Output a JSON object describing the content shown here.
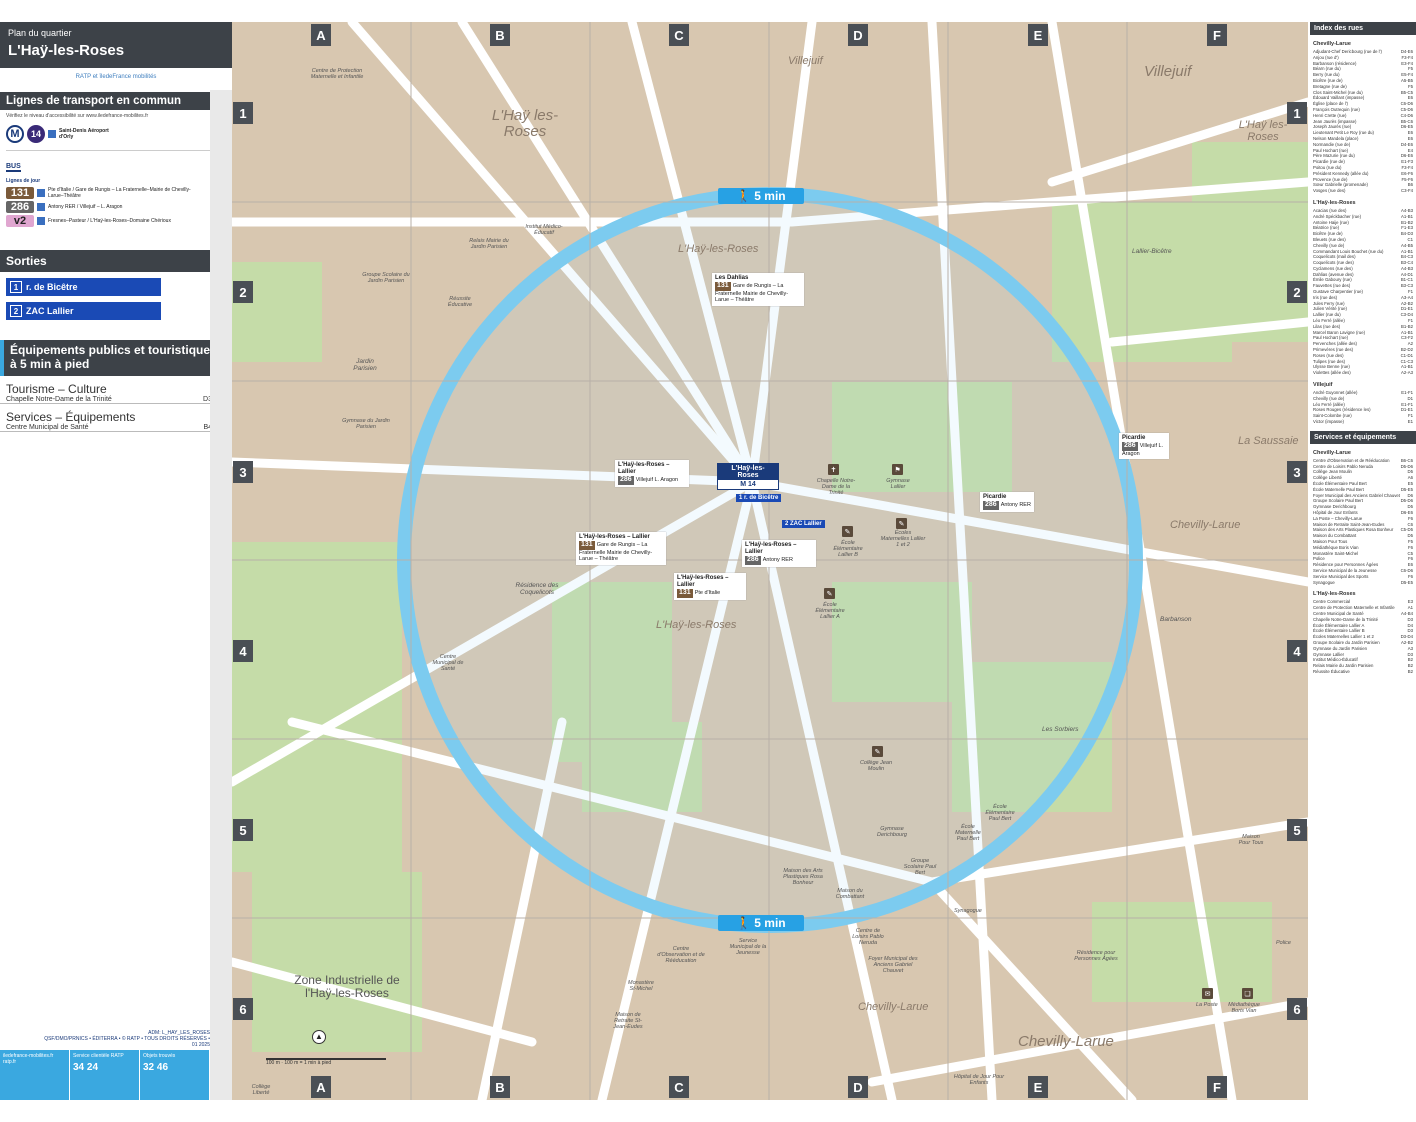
{
  "header": {
    "subtitle": "Plan du quartier",
    "title": "L'Haÿ-les-Roses"
  },
  "logos": {
    "text": "RATP  et  îledeFrance mobilités"
  },
  "transport": {
    "heading": "Lignes de transport en commun",
    "note": "Vérifiez le niveau d'accessibilité sur www.iledefrance-mobilites.fr",
    "metro": {
      "m": "M",
      "line": "14",
      "dest": "Saint-Denis Aéroport d'Orly"
    },
    "bus_label": "BUS",
    "lignes_label": "Lignes de jour",
    "lines": [
      {
        "num": "131",
        "desc": "Pte d'Italie / Gare de Rungis – La Fraternelle–Mairie de Chevilly-Larue–Théâtre",
        "color": "#7a5a3a"
      },
      {
        "num": "286",
        "desc": "Antony RER / Villejuif – L. Aragon",
        "color": "#666666"
      },
      {
        "num": "v2",
        "desc": "Fresnes–Pasteur / L'Haÿ-les-Roses–Domaine Chérioux",
        "color": "#e0a6d0"
      }
    ]
  },
  "sorties": {
    "heading": "Sorties",
    "items": [
      {
        "num": "1",
        "label": "r. de Bicêtre"
      },
      {
        "num": "2",
        "label": "ZAC Lallier"
      }
    ]
  },
  "equipements": {
    "heading": "Équipements publics et touristiques à 5 min à pied",
    "categories": [
      {
        "title": "Tourisme – Culture",
        "items": [
          {
            "name": "Chapelle Notre-Dame de la Trinité",
            "ref": "D3"
          }
        ]
      },
      {
        "title": "Services – Équipements",
        "items": [
          {
            "name": "Centre Municipal de Santé",
            "ref": "B4"
          }
        ]
      }
    ]
  },
  "credits": {
    "ref": "ADM: L_HAY_LES_ROSES",
    "line2": "QSF/DMO/PRNICS • ÉDITERRA • © RATP • TOUS DROITS RÉSERVÉS • 01 2025"
  },
  "footer": [
    {
      "title": "iledefrance-mobilites.fr ratp.fr",
      "num": ""
    },
    {
      "title": "Service clientèle RATP",
      "num": "34 24"
    },
    {
      "title": "Objets trouvés",
      "num": "32 46"
    }
  ],
  "grid": {
    "letters": [
      "A",
      "B",
      "C",
      "D",
      "E",
      "F"
    ],
    "numbers": [
      "1",
      "2",
      "3",
      "4",
      "5",
      "6"
    ]
  },
  "map": {
    "walk_label": "5 min",
    "places": [
      {
        "name": "L'Haÿ les-Roses"
      },
      {
        "name": "Villejuif"
      },
      {
        "name": "Villejuif"
      },
      {
        "name": "L'Haÿ les-Roses"
      },
      {
        "name": "L'Haÿ-les-Roses"
      },
      {
        "name": "L'Haÿ-les-Roses"
      },
      {
        "name": "La Saussaie"
      },
      {
        "name": "Chevilly-Larue"
      },
      {
        "name": "Chevilly-Larue"
      },
      {
        "name": "Chevilly-Larue"
      },
      {
        "name": "Lallier-Bicêtre"
      },
      {
        "name": "Jardin Parisien"
      },
      {
        "name": "Barbanson"
      },
      {
        "name": "Les Sorbiers"
      },
      {
        "name": "Résidence des Coquelicots"
      },
      {
        "name": "Zone Industrielle de l'Haÿ-les-Roses"
      }
    ],
    "station": {
      "name": "L'Haÿ-les-Roses",
      "m": "M",
      "line": "14"
    },
    "exits": [
      {
        "num": "1",
        "label": "r. de Bicêtre"
      },
      {
        "num": "2",
        "label": "ZAC Lallier"
      }
    ],
    "stops": [
      {
        "name": "Les Dahlias",
        "line": "131",
        "dir": "Gare de Rungis – La Fraternelle Mairie de Chevilly-Larue – Théâtre"
      },
      {
        "name": "L'Haÿ-les-Roses – Lallier",
        "line": "286",
        "dir": "Villejuif L. Aragon"
      },
      {
        "name": "L'Haÿ-les-Roses – Lallier",
        "line": "131",
        "dir": "Gare de Rungis – La Fraternelle Mairie de Chevilly-Larue – Théâtre"
      },
      {
        "name": "L'Haÿ-les-Roses – Lallier",
        "line": "286",
        "dir": "Antony RER"
      },
      {
        "name": "L'Haÿ-les-Roses – Lallier",
        "line": "131",
        "dir": "Pte d'Italie"
      },
      {
        "name": "Picardie",
        "line": "286",
        "dir": "Antony RER"
      },
      {
        "name": "Picardie",
        "line": "286",
        "dir": "Villejuif L. Aragon"
      }
    ],
    "pois": [
      {
        "name": "Centre de Protection Maternelle et Infantile"
      },
      {
        "name": "Relais Mairie du Jardin Parisien"
      },
      {
        "name": "Institut Médico-Éducatif"
      },
      {
        "name": "Groupe Scolaire du Jardin Parisien"
      },
      {
        "name": "Réussite Éducative"
      },
      {
        "name": "Gymnase du Jardin Parisien"
      },
      {
        "name": "Chapelle Notre-Dame de la Trinité"
      },
      {
        "name": "Gymnase Lallier"
      },
      {
        "name": "École Élémentaire Lallier B"
      },
      {
        "name": "Écoles Maternelles Lallier 1 et 2"
      },
      {
        "name": "École Élémentaire Lallier A"
      },
      {
        "name": "Centre Municipal de Santé"
      },
      {
        "name": "Collège Jean Moulin"
      },
      {
        "name": "Gymnase Derichbourg"
      },
      {
        "name": "Groupe Scolaire Paul Bert"
      },
      {
        "name": "École Élémentaire Paul Bert"
      },
      {
        "name": "École Maternelle Paul Bert"
      },
      {
        "name": "Synagogue"
      },
      {
        "name": "Maison des Arts Plastiques Rosa Bonheur"
      },
      {
        "name": "Maison du Combattant"
      },
      {
        "name": "Service Municipal de la Jeunesse"
      },
      {
        "name": "Centre d'Observation et de Rééducation"
      },
      {
        "name": "Centre de Loisirs Pablo Neruda"
      },
      {
        "name": "Foyer Municipal des Anciens Gabriel Chauvet"
      },
      {
        "name": "Résidence pour Personnes Âgées"
      },
      {
        "name": "Monastère St-Michel"
      },
      {
        "name": "Maison de Retraite St-Jean-Eudes"
      },
      {
        "name": "Hôpital de Jour Pour Enfants"
      },
      {
        "name": "La Poste"
      },
      {
        "name": "Médiathèque Boris Vian"
      },
      {
        "name": "Maison Pour Tous"
      },
      {
        "name": "Police"
      },
      {
        "name": "Collège Liberté"
      }
    ],
    "scale": "100 m",
    "scale_sub": "100 m = 1 min à pied"
  },
  "index": {
    "heading": "Index des rues",
    "groups": [
      {
        "name": "Chevilly-Larue",
        "items": [
          [
            "Adjudant-Chef Dericbourg (rue de l')",
            "D4-E6"
          ],
          [
            "Anjou (rue d')",
            "F3-F4"
          ],
          [
            "Barbanson (résidence)",
            "E3-F4"
          ],
          [
            "Béarn (rue du)",
            "F5"
          ],
          [
            "Berry (rue du)",
            "E5-F4"
          ],
          [
            "Bicêtre (rue de)",
            "A5-B5"
          ],
          [
            "Bretagne (rue de)",
            "F5"
          ],
          [
            "Clos Saint-Michel (rue du)",
            "B5-C5"
          ],
          [
            "Édouard Vaillant (impasse)",
            "E6"
          ],
          [
            "Église (place de l')",
            "C6-D6"
          ],
          [
            "François Outrequin (rue)",
            "C5-D6"
          ],
          [
            "Henri Crette (rue)",
            "C4-D6"
          ],
          [
            "Jean Jaurès (impasse)",
            "B5-C6"
          ],
          [
            "Joseph Jaurès (rue)",
            "D6-E5"
          ],
          [
            "Lieutenant Petit Le Roy (rue du)",
            "E6"
          ],
          [
            "Nelson Mandela (place)",
            "E6"
          ],
          [
            "Normandie (rue de)",
            "D4-E6"
          ],
          [
            "Paul Hochart (rue)",
            "E4"
          ],
          [
            "Père Mazurie (rue du)",
            "D6-E6"
          ],
          [
            "Picardie (rue de)",
            "E1-F3"
          ],
          [
            "Poitou (rue du)",
            "F3-F4"
          ],
          [
            "Président Kennedy (allée du)",
            "E6-F6"
          ],
          [
            "Provence (rue de)",
            "F5-F6"
          ],
          [
            "Sœur Gabrielle (promenade)",
            "B6"
          ],
          [
            "Vosges (rue des)",
            "C3-F4"
          ]
        ]
      },
      {
        "name": "L'Haÿ-les-Roses",
        "items": [
          [
            "Acacias (rue des)",
            "A4-B3"
          ],
          [
            "André Spéckbacher (rue)",
            "A1-B1"
          ],
          [
            "Antoine Haije (rue)",
            "B1-B2"
          ],
          [
            "Béatrice (rue)",
            "F1-E3"
          ],
          [
            "Bicêtre (rue de)",
            "B4-D3"
          ],
          [
            "Bleuets (rue des)",
            "C1"
          ],
          [
            "Chevilly (rue de)",
            "A4-B5"
          ],
          [
            "Commandant Louis Bouchet (rue du)",
            "A1-B1"
          ],
          [
            "Coquelicots (mail des)",
            "B4-C3"
          ],
          [
            "Coquelicots (rue des)",
            "B3-C4"
          ],
          [
            "Cyclamens (rue des)",
            "A4-B3"
          ],
          [
            "Dahlias (avenue des)",
            "A4-D1"
          ],
          [
            "Émile Gaboury (rue)",
            "B1-C1"
          ],
          [
            "Fauvettes (rue des)",
            "B3-C3"
          ],
          [
            "Gustave Charpentier (rue)",
            "F1"
          ],
          [
            "Iris (rue des)",
            "A3-A4"
          ],
          [
            "Jules Ferry (rue)",
            "A2-B2"
          ],
          [
            "Julien Vérité (rue)",
            "D1-E1"
          ],
          [
            "Lallier (rue du)",
            "C3-D4"
          ],
          [
            "Léo Ferré (allée)",
            "F1"
          ],
          [
            "Lilas (rue des)",
            "B1-B2"
          ],
          [
            "Marcel Baron Lavigne (rue)",
            "A1-B1"
          ],
          [
            "Paul Hochart (rue)",
            "C3-F2"
          ],
          [
            "Pervenches (allée des)",
            "A2"
          ],
          [
            "Primevères (rue des)",
            "B2-D2"
          ],
          [
            "Roses (rue des)",
            "C1-D1"
          ],
          [
            "Tulipes (rue des)",
            "C1-C3"
          ],
          [
            "Ulysse Benne (rue)",
            "A1-B1"
          ],
          [
            "Violettes (allée des)",
            "A2-A3"
          ]
        ]
      },
      {
        "name": "Villejuif",
        "items": [
          [
            "André Guyonnet (allée)",
            "E1-F1"
          ],
          [
            "Chevilly (rue de)",
            "D1"
          ],
          [
            "Léo Ferré (allée)",
            "E1-F1"
          ],
          [
            "Roses Rouges (résidence les)",
            "D1-E1"
          ],
          [
            "Saint-Colombe (rue)",
            "F1"
          ],
          [
            "Victor (impasse)",
            "E1"
          ]
        ]
      }
    ],
    "services_heading": "Services et équipements",
    "services_groups": [
      {
        "name": "Chevilly-Larue",
        "items": [
          [
            "Centre d'Observation et de Rééducation",
            "B6-C6"
          ],
          [
            "Centre de Loisirs Pablo Neruda",
            "D5-D6"
          ],
          [
            "Collège Jean Moulin",
            "D5"
          ],
          [
            "Collège Liberté",
            "A6"
          ],
          [
            "École Élémentaire Paul Bert",
            "E5"
          ],
          [
            "École Maternelle Paul Bert",
            "D5-E5"
          ],
          [
            "Foyer Municipal des Anciens Gabriel Chauvet",
            "D6"
          ],
          [
            "Groupe Scolaire Paul Bert",
            "D5-D6"
          ],
          [
            "Gymnase Derichbourg",
            "D5"
          ],
          [
            "Hôpital de Jour Enfants",
            "D6-E6"
          ],
          [
            "La Poste – Chevilly-Larue",
            "F6"
          ],
          [
            "Maison de Retraite Saint-Jean-Eudes",
            "C6"
          ],
          [
            "Maison des Arts Plastiques Rosa Bonheur",
            "C5-D5"
          ],
          [
            "Maison du Combattant",
            "D5"
          ],
          [
            "Maison Pour Tous",
            "F5"
          ],
          [
            "Médiathèque Boris Vian",
            "F6"
          ],
          [
            "Monastère Saint-Michel",
            "C5"
          ],
          [
            "Police",
            "F6"
          ],
          [
            "Résidence pour Personnes Âgées",
            "E6"
          ],
          [
            "Service Municipal de la Jeunesse",
            "C6-D6"
          ],
          [
            "Service Municipal des Sports",
            "F6"
          ],
          [
            "Synagogue",
            "D5-E5"
          ]
        ]
      },
      {
        "name": "L'Haÿ-les-Roses",
        "items": [
          [
            "Centre Commercial",
            "E3"
          ],
          [
            "Centre de Protection Maternelle et Infantile",
            "A1"
          ],
          [
            "Centre Municipal de Santé",
            "A4-B4"
          ],
          [
            "Chapelle Notre-Dame de la Trinité",
            "D3"
          ],
          [
            "École Élémentaire Lallier A",
            "D4"
          ],
          [
            "École Élémentaire Lallier B",
            "D3"
          ],
          [
            "Écoles Maternelles Lallier 1 et 2",
            "D3-D4"
          ],
          [
            "Groupe Scolaire du Jardin Parisien",
            "A2-B2"
          ],
          [
            "Gymnase du Jardin Parisien",
            "A3"
          ],
          [
            "Gymnase Lallier",
            "D3"
          ],
          [
            "Institut Médico-Éducatif",
            "B2"
          ],
          [
            "Relais Mairie du Jardin Parisien",
            "B2"
          ],
          [
            "Réussite Éducative",
            "B2"
          ]
        ]
      }
    ]
  }
}
